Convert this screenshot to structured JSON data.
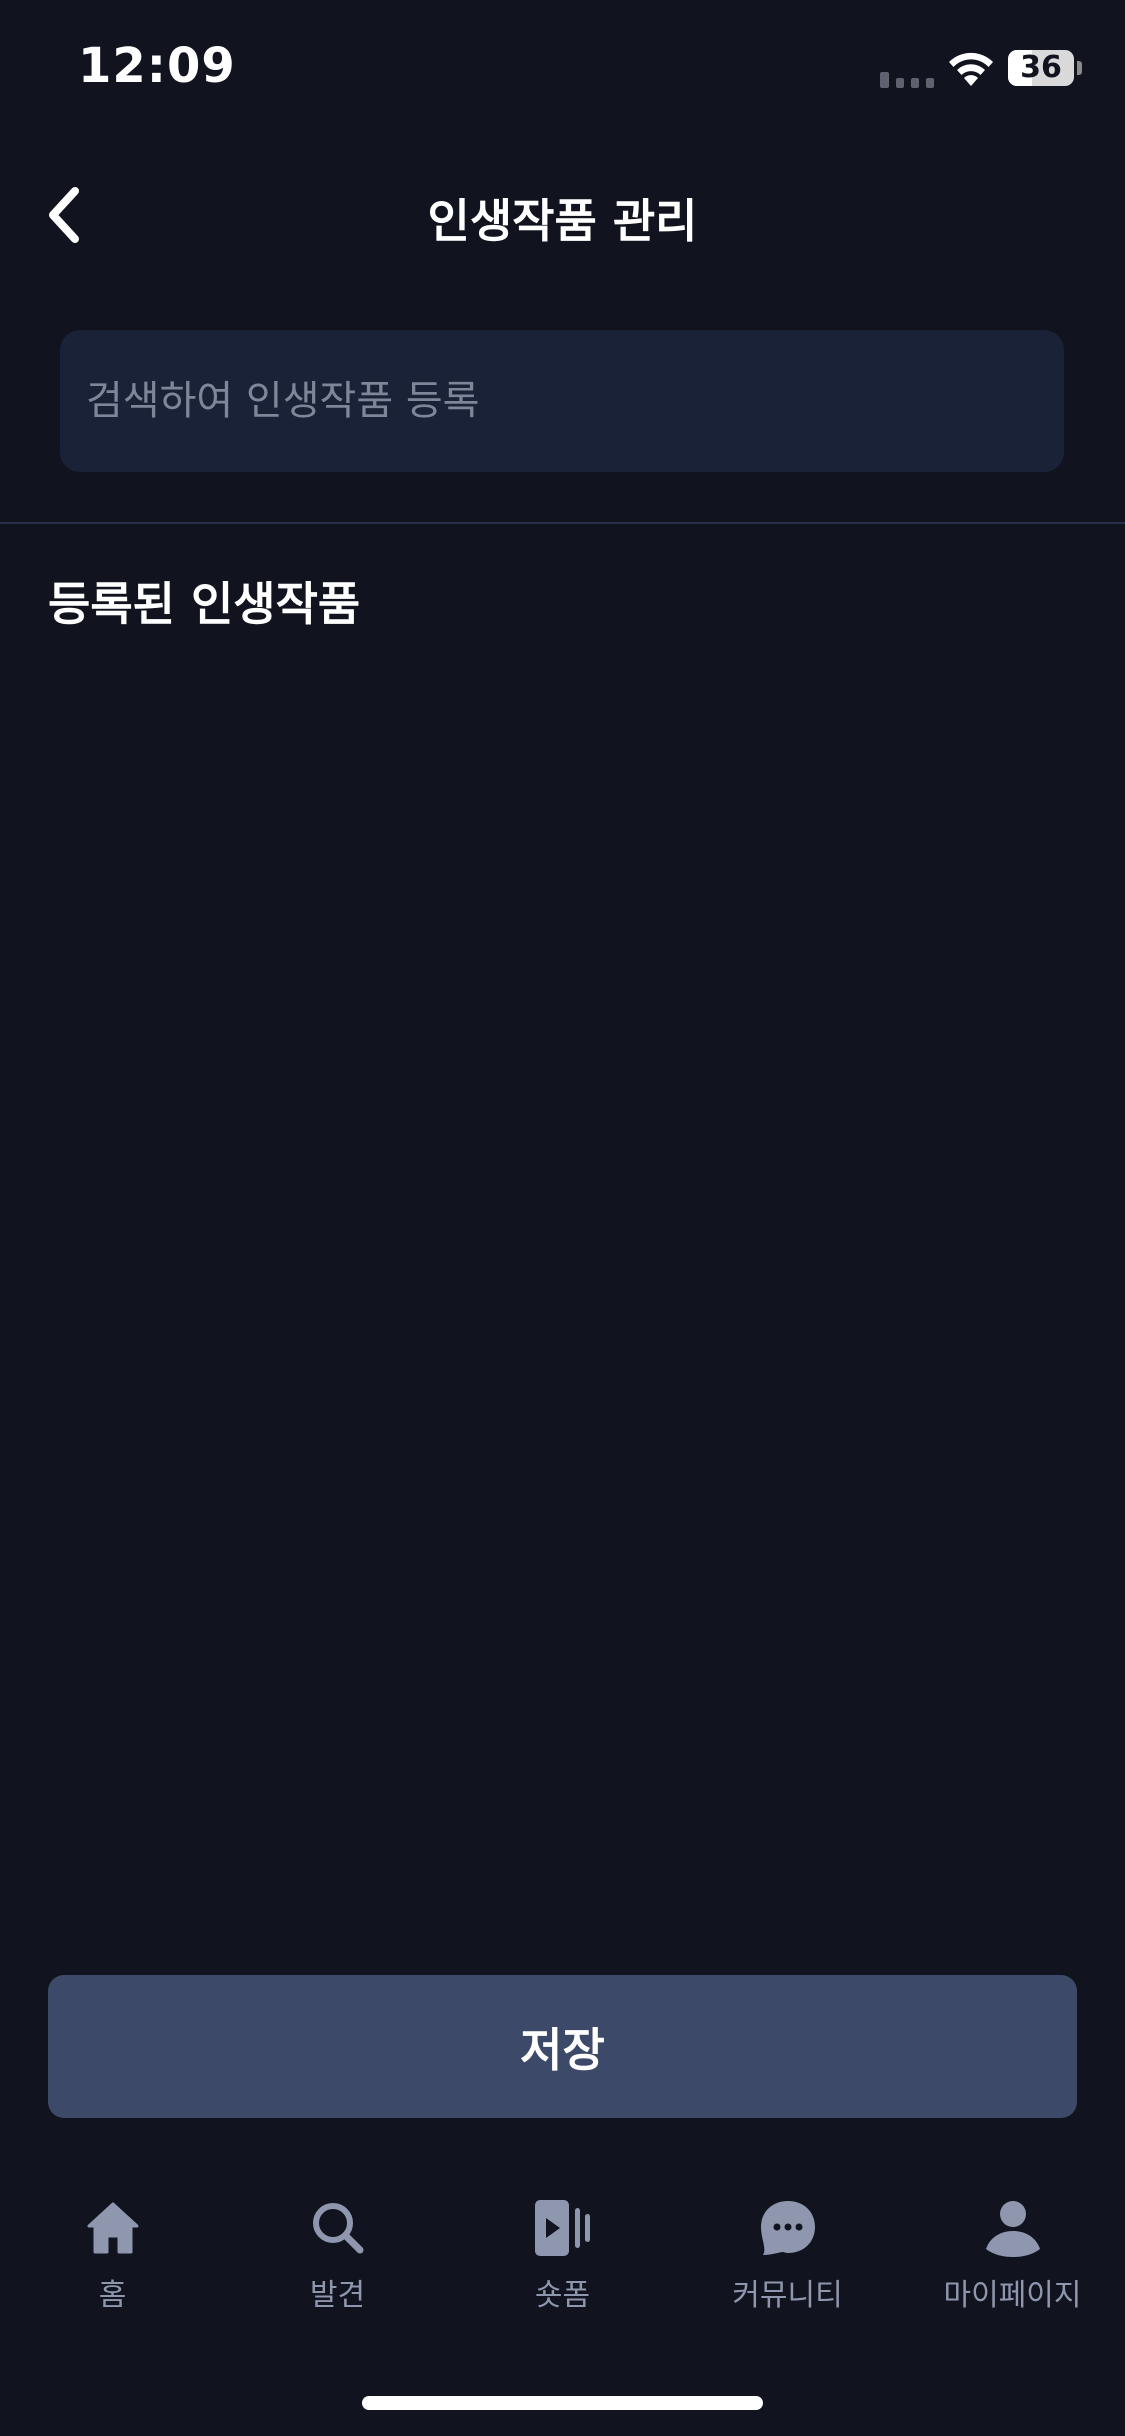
{
  "status_bar": {
    "time": "12:09",
    "battery": "36"
  },
  "header": {
    "title": "인생작품 관리"
  },
  "search": {
    "placeholder": "검색하여 인생작품 등록",
    "value": ""
  },
  "section": {
    "title": "등록된 인생작품"
  },
  "save_button": {
    "label": "저장"
  },
  "tab_bar": {
    "items": [
      {
        "label": "홈",
        "icon": "home-icon"
      },
      {
        "label": "발견",
        "icon": "search-icon"
      },
      {
        "label": "숏폼",
        "icon": "shortform-icon"
      },
      {
        "label": "커뮤니티",
        "icon": "chat-bubble-icon"
      },
      {
        "label": "마이페이지",
        "icon": "person-icon"
      }
    ]
  },
  "colors": {
    "background": "#11131f",
    "search_bg": "#1a2238",
    "save_button_bg": "#3c4968",
    "tab_inactive": "#8e97ad"
  }
}
